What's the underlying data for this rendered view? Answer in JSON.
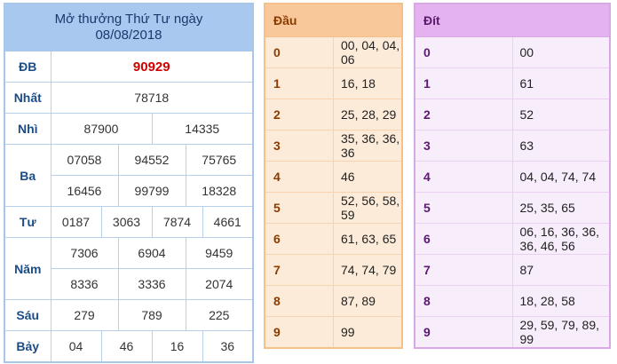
{
  "results": {
    "title_line1": "Mở thưởng Thứ Tư ngày",
    "title_line2": "08/08/2018",
    "db": {
      "label": "ĐB",
      "values": [
        "90929"
      ]
    },
    "nhat": {
      "label": "Nhất",
      "values": [
        "78718"
      ]
    },
    "nhi": {
      "label": "Nhì",
      "values": [
        "87900",
        "14335"
      ]
    },
    "ba": {
      "label": "Ba",
      "values": [
        "07058",
        "94552",
        "75765",
        "16456",
        "99799",
        "18328"
      ]
    },
    "tu": {
      "label": "Tư",
      "values": [
        "0187",
        "3063",
        "7874",
        "4661"
      ]
    },
    "nam": {
      "label": "Năm",
      "values": [
        "7306",
        "6904",
        "9459",
        "8336",
        "3336",
        "2074"
      ]
    },
    "sau": {
      "label": "Sáu",
      "values": [
        "279",
        "789",
        "225"
      ]
    },
    "bay": {
      "label": "Bảy",
      "values": [
        "04",
        "46",
        "16",
        "36"
      ]
    }
  },
  "dau": {
    "header": "Đầu",
    "rows": [
      {
        "key": "0",
        "value": "00, 04, 04, 06"
      },
      {
        "key": "1",
        "value": "16, 18"
      },
      {
        "key": "2",
        "value": "25, 28, 29"
      },
      {
        "key": "3",
        "value": "35, 36, 36, 36"
      },
      {
        "key": "4",
        "value": "46"
      },
      {
        "key": "5",
        "value": "52, 56, 58, 59"
      },
      {
        "key": "6",
        "value": "61, 63, 65"
      },
      {
        "key": "7",
        "value": "74, 74, 79"
      },
      {
        "key": "8",
        "value": "87, 89"
      },
      {
        "key": "9",
        "value": "99"
      }
    ]
  },
  "dit": {
    "header": "Đít",
    "rows": [
      {
        "key": "0",
        "value": "00"
      },
      {
        "key": "1",
        "value": "61"
      },
      {
        "key": "2",
        "value": "52"
      },
      {
        "key": "3",
        "value": "63"
      },
      {
        "key": "4",
        "value": "04, 04, 74, 74"
      },
      {
        "key": "5",
        "value": "25, 35, 65"
      },
      {
        "key": "6",
        "value": "06, 16, 36, 36, 36, 46, 56"
      },
      {
        "key": "7",
        "value": "87"
      },
      {
        "key": "8",
        "value": "18, 28, 58"
      },
      {
        "key": "9",
        "value": "29, 59, 79, 89, 99"
      }
    ]
  }
}
